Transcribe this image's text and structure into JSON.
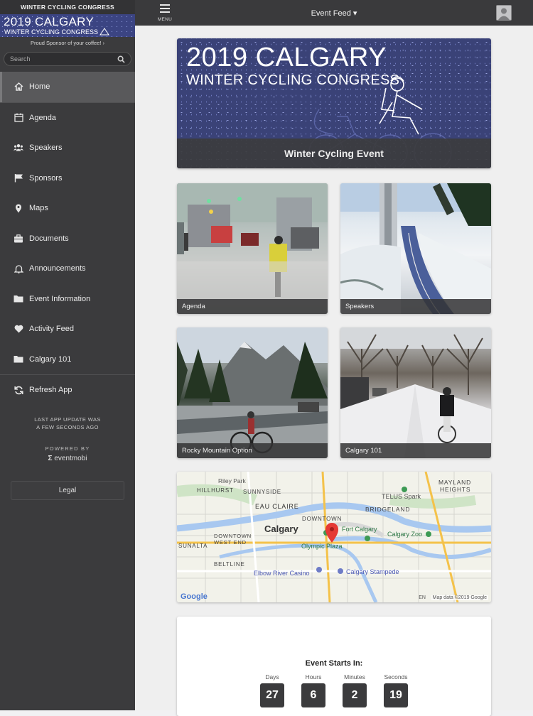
{
  "sidebar": {
    "title": "WINTER CYCLING CONGRESS",
    "banner_line1": "2019 CALGARY",
    "banner_line2": "WINTER CYCLING CONGRESS",
    "sponsor_text": "Proud Sponsor of your coffee! ›",
    "search_placeholder": "Search",
    "items": [
      {
        "label": "Home",
        "icon": "home-icon"
      },
      {
        "label": "Agenda",
        "icon": "calendar-icon"
      },
      {
        "label": "Speakers",
        "icon": "group-icon"
      },
      {
        "label": "Sponsors",
        "icon": "flag-icon"
      },
      {
        "label": "Maps",
        "icon": "map-pin-icon"
      },
      {
        "label": "Documents",
        "icon": "briefcase-icon"
      },
      {
        "label": "Announcements",
        "icon": "bell-icon"
      },
      {
        "label": "Event Information",
        "icon": "folder-icon"
      },
      {
        "label": "Activity Feed",
        "icon": "heart-icon"
      },
      {
        "label": "Calgary 101",
        "icon": "folder-icon"
      }
    ],
    "refresh_label": "Refresh App",
    "update_line1": "LAST APP UPDATE WAS",
    "update_line2": "A FEW SECONDS AGO",
    "powered_by": "POWERED BY",
    "powered_logo": "eventmobi",
    "legal_label": "Legal"
  },
  "topbar": {
    "menu_label": "MENU",
    "title": "Event Feed ▾"
  },
  "hero": {
    "line1": "2019 CALGARY",
    "line2": "WINTER CYCLING CONGRESS",
    "caption": "Winter Cycling Event"
  },
  "tiles": [
    {
      "caption": "Agenda"
    },
    {
      "caption": "Speakers"
    },
    {
      "caption": "Rocky Mountain Option"
    },
    {
      "caption": "Calgary 101"
    }
  ],
  "map": {
    "labels": [
      "Riley Park",
      "HILLHURST",
      "SUNNYSIDE",
      "EAU CLAIRE",
      "DOWNTOWN",
      "Calgary",
      "Fort Calgary",
      "Calgary Zoo",
      "TELUS Spark",
      "BRIDGELAND",
      "MAYLAND",
      "HEIGHTS",
      "SUNALTA",
      "DOWNTOWN WEST END",
      "BELTLINE",
      "Olympic Plaza",
      "Elbow River Casino",
      "Calgary Stampede"
    ],
    "attribution": "Map data ©2019 Google",
    "google": "Google",
    "locale": "EN"
  },
  "countdown": {
    "title": "Event Starts In:",
    "units": [
      {
        "label": "Days",
        "value": "27"
      },
      {
        "label": "Hours",
        "value": "6"
      },
      {
        "label": "Minutes",
        "value": "2"
      },
      {
        "label": "Seconds",
        "value": "19"
      }
    ]
  },
  "colors": {
    "sidebar_bg": "#3b3b3d",
    "topbar_bg": "#3a3a3c",
    "hero_bg": "#3a4277",
    "map_pin": "#e53935"
  }
}
